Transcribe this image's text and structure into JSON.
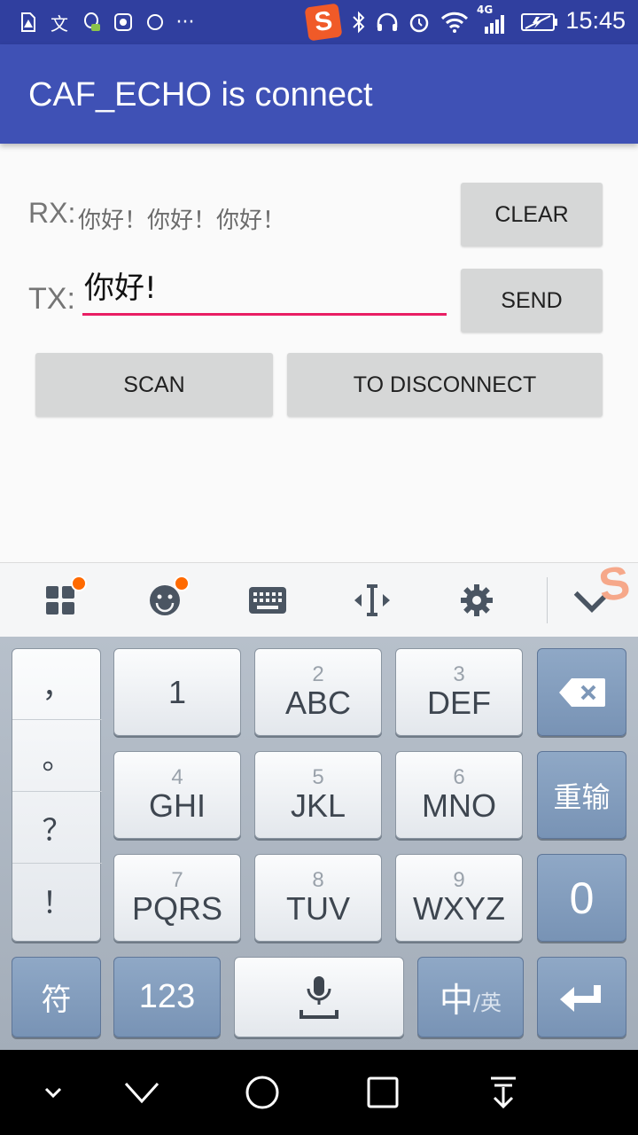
{
  "status_bar": {
    "time": "15:45",
    "network_label": "4G",
    "icons": [
      "warning-icon",
      "translate-icon",
      "qq-icon",
      "sogou-s-icon",
      "ring-icon",
      "more-icon",
      "bluetooth-icon",
      "headphones-icon",
      "alarm-icon",
      "wifi-icon",
      "signal-icon",
      "battery-icon"
    ]
  },
  "app_bar": {
    "title": "CAF_ECHO is connect"
  },
  "rx": {
    "label": "RX:",
    "text": "你好！你好！你好！"
  },
  "tx": {
    "label": "TX:",
    "value": "你好!"
  },
  "buttons": {
    "clear": "CLEAR",
    "send": "SEND",
    "scan": "SCAN",
    "disconnect": "TO DISCONNECT"
  },
  "ime_toolbar": {
    "icons": [
      "apps-icon",
      "emoji-icon",
      "keyboard-icon",
      "cursor-icon",
      "settings-icon",
      "collapse-icon"
    ]
  },
  "keyboard": {
    "punctuation": [
      "，",
      "。",
      "？",
      "！"
    ],
    "keys": [
      {
        "num": "",
        "text": "1"
      },
      {
        "num": "2",
        "text": "ABC"
      },
      {
        "num": "3",
        "text": "DEF"
      },
      {
        "num": "4",
        "text": "GHI"
      },
      {
        "num": "5",
        "text": "JKL"
      },
      {
        "num": "6",
        "text": "MNO"
      },
      {
        "num": "7",
        "text": "PQRS"
      },
      {
        "num": "8",
        "text": "TUV"
      },
      {
        "num": "9",
        "text": "WXYZ"
      }
    ],
    "retype": "重输",
    "zero": "0",
    "symbol": "符",
    "numbers": "123",
    "lang_main": "中",
    "lang_alt": "/英"
  },
  "colors": {
    "status_bar": "#303f9f",
    "app_bar": "#3f51b5",
    "accent": "#e91e63",
    "button": "#d6d7d7"
  }
}
